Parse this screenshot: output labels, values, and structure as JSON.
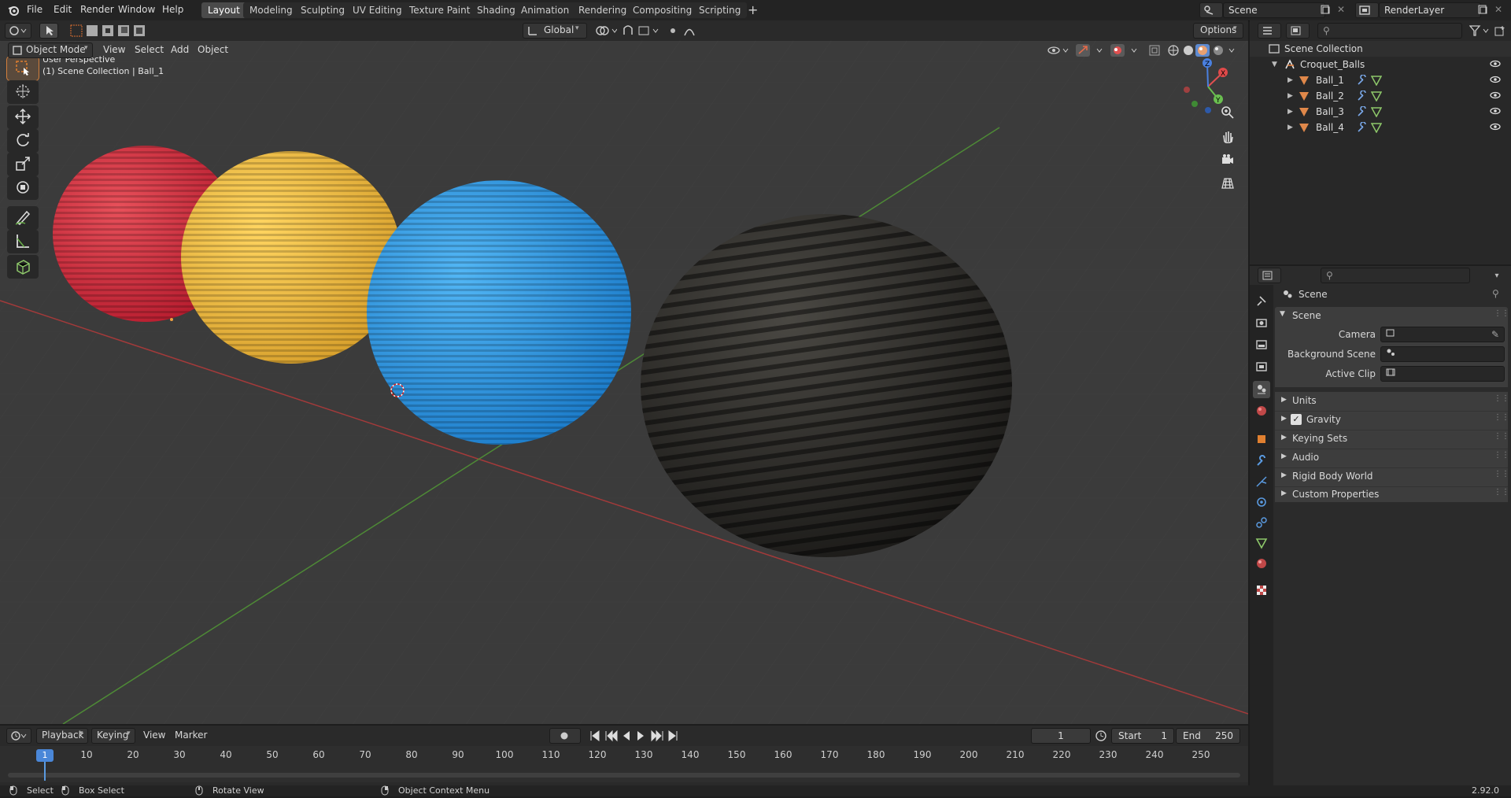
{
  "topbar": {
    "menus": [
      "File",
      "Edit",
      "Render",
      "Window",
      "Help"
    ],
    "workspaces": [
      "Layout",
      "Modeling",
      "Sculpting",
      "UV Editing",
      "Texture Paint",
      "Shading",
      "Animation",
      "Rendering",
      "Compositing",
      "Scripting"
    ],
    "active_workspace": "Layout",
    "add_tab_label": "+",
    "scene_name": "Scene",
    "view_layer": "RenderLayer"
  },
  "viewport_header": {
    "mode": "Object Mode",
    "menus": [
      "View",
      "Select",
      "Add",
      "Object"
    ],
    "transform_orientation": "Global",
    "options_label": "Options"
  },
  "viewport": {
    "perspective_label": "User Perspective",
    "collection_label": "(1) Scene Collection | Ball_1",
    "colors": {
      "ball_red": "#d9283a",
      "ball_yellow": "#f2c040",
      "ball_blue": "#2a9ce8",
      "ball_black": "#2e2d2a",
      "axis_x": "#b03a3a",
      "axis_y": "#5a9a3c"
    },
    "tools": [
      "select-box-icon",
      "cursor-icon",
      "move-icon",
      "rotate-icon",
      "scale-icon",
      "transform-icon",
      "annotate-icon",
      "measure-icon",
      "add-cube-icon"
    ]
  },
  "outliner": {
    "root": "Scene Collection",
    "collection": "Croquet_Balls",
    "objects": [
      "Ball_1",
      "Ball_2",
      "Ball_3",
      "Ball_4"
    ]
  },
  "properties": {
    "context": "Scene",
    "panel_title": "Scene",
    "fields": [
      {
        "label": "Camera",
        "value": ""
      },
      {
        "label": "Background Scene",
        "value": ""
      },
      {
        "label": "Active Clip",
        "value": ""
      }
    ],
    "sections": [
      {
        "label": "Units",
        "checkbox": false
      },
      {
        "label": "Gravity",
        "checkbox": true,
        "checked": true
      },
      {
        "label": "Keying Sets",
        "checkbox": false
      },
      {
        "label": "Audio",
        "checkbox": false
      },
      {
        "label": "Rigid Body World",
        "checkbox": false
      },
      {
        "label": "Custom Properties",
        "checkbox": false
      }
    ]
  },
  "timeline": {
    "menus": [
      "Playback",
      "Keying",
      "View",
      "Marker"
    ],
    "current_frame": "1",
    "start_label": "Start",
    "start": "1",
    "end_label": "End",
    "end": "250",
    "ticks": [
      "10",
      "20",
      "30",
      "40",
      "50",
      "60",
      "70",
      "80",
      "90",
      "100",
      "110",
      "120",
      "130",
      "140",
      "150",
      "160",
      "170",
      "180",
      "190",
      "200",
      "210",
      "220",
      "230",
      "240",
      "250"
    ]
  },
  "statusbar": {
    "select": "Select",
    "box_select": "Box Select",
    "rotate_view": "Rotate View",
    "context_menu": "Object Context Menu",
    "version": "2.92.0"
  }
}
